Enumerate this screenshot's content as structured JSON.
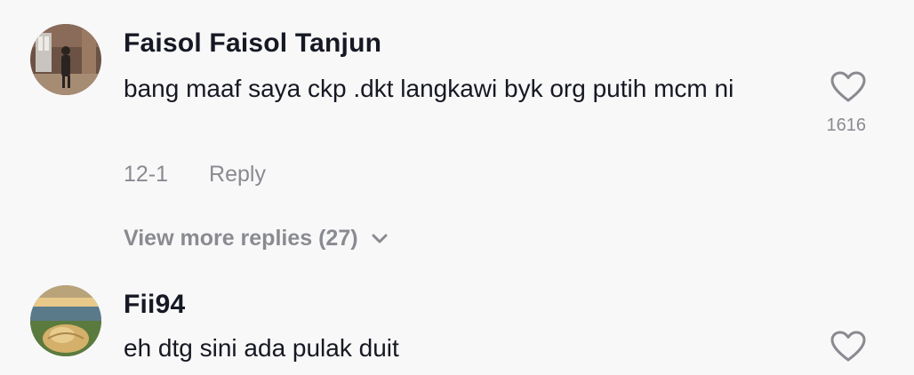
{
  "comments": [
    {
      "username": "Faisol Faisol Tanjun",
      "text": "bang maaf saya ckp .dkt langkawi byk org putih mcm ni",
      "date": "12-1",
      "reply_label": "Reply",
      "like_count": "1616",
      "avatar_icon": "user-photo-avatar",
      "view_more_label": "View more replies (27)"
    },
    {
      "username": "Fii94",
      "text": "eh dtg sini ada pulak duit",
      "avatar_icon": "user-photo-avatar"
    }
  ],
  "icons": {
    "like": "heart-outline-icon",
    "expand": "chevron-down-icon"
  },
  "colors": {
    "background": "#f8f8f8",
    "primary_text": "#161823",
    "secondary_text": "#8a8b91"
  }
}
